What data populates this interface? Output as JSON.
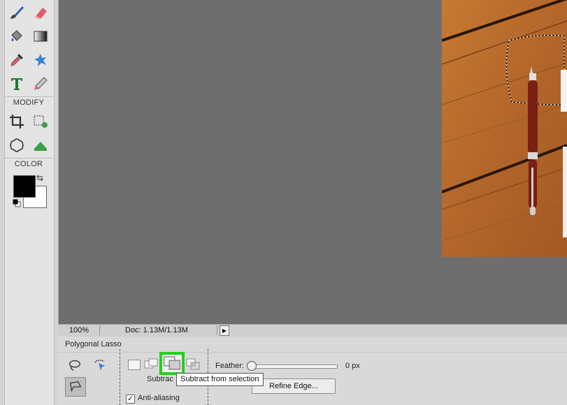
{
  "toolbox": {
    "modify_label": "MODIFY",
    "color_label": "COLOR",
    "tools": [
      {
        "icon": "brush-icon"
      },
      {
        "icon": "eraser-icon"
      },
      {
        "icon": "paint-bucket-icon"
      },
      {
        "icon": "gradient-icon"
      },
      {
        "icon": "eyedropper-icon"
      },
      {
        "icon": "custom-shape-icon"
      },
      {
        "icon": "type-icon"
      },
      {
        "icon": "pencil-icon"
      },
      {
        "icon": "crop-icon"
      },
      {
        "icon": "recompose-icon"
      },
      {
        "icon": "cookie-cutter-icon"
      },
      {
        "icon": "straighten-icon"
      }
    ],
    "foreground_color": "#000000",
    "background_color": "#ffffff"
  },
  "statusbar": {
    "zoom": "100%",
    "doc_info": "Doc: 1.13M/1.13M"
  },
  "options": {
    "tool_name": "Polygonal Lasso",
    "mode_label": "Subtrac",
    "tooltip": "Subtract from selection",
    "feather_label": "Feather:",
    "feather_value": "0 px",
    "feather_level": 0,
    "refine_edge_label": "Refine Edge...",
    "anti_aliasing_label": "Anti-aliasing",
    "anti_aliasing_checked": true
  },
  "colors": {
    "highlight": "#22d11a",
    "canvas": "#6e6e6e"
  }
}
